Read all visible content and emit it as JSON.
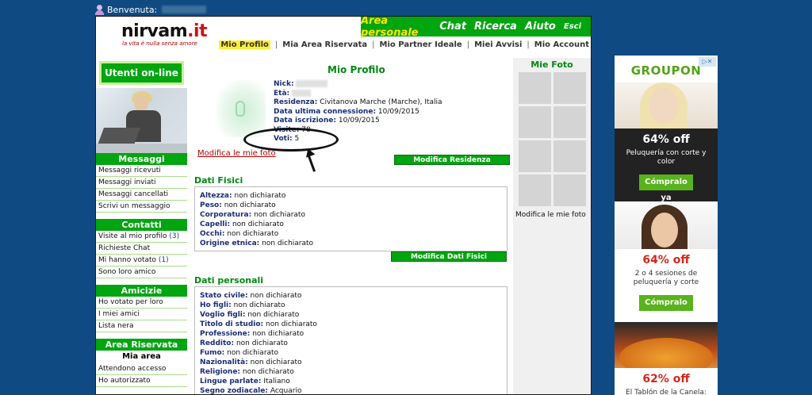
{
  "topbar": {
    "welcome": "Benvenuta:"
  },
  "header": {
    "logo_text": "nirvam",
    "logo_suffix": ".it",
    "tagline": "la vita è nulla senza amore",
    "mainnav": [
      "Area personale",
      "Chat",
      "Ricerca",
      "Aiuto",
      "Esci"
    ],
    "subnav": [
      "Mio Profilo",
      "Mia Area Riservata",
      "Mio Partner Ideale",
      "Miei Avvisi",
      "Mio Account"
    ]
  },
  "sidebar": {
    "online_button": "Utenti on-line",
    "messaggi": {
      "title": "Messaggi",
      "items": [
        "Messaggi ricevuti",
        "Messaggi inviati",
        "Messaggi cancellati",
        "Scrivi un messaggio"
      ]
    },
    "contatti": {
      "title": "Contatti",
      "items": [
        {
          "label": "Visite al mio profilo",
          "count": "(3)"
        },
        {
          "label": "Richieste Chat",
          "count": ""
        },
        {
          "label": "Mi hanno votato",
          "count": "(1)"
        },
        {
          "label": "Sono loro amico",
          "count": ""
        }
      ]
    },
    "amicizie": {
      "title": "Amicizie",
      "items": [
        "Ho votato per loro",
        "I miei amici",
        "Lista nera"
      ]
    },
    "area_riservata": {
      "title": "Area Riservata",
      "subtitle": "Mia area",
      "items": [
        "Attendono accesso",
        "Ho autorizzato"
      ]
    }
  },
  "profile": {
    "title": "Mio Profilo",
    "labels": {
      "nick": "Nick:",
      "eta": "Età:",
      "residenza": "Residenza:",
      "ultima": "Data ultima connessione:",
      "iscrizione": "Data iscrizione:",
      "visite": "Visite:",
      "voti": "Voti:"
    },
    "residenza": "Civitanova Marche (Marche), Italia",
    "ultima": "10/09/2015",
    "iscrizione": "10/09/2015",
    "visite": "78",
    "voti": "5",
    "modifica_foto": "Modifica le mie foto",
    "modifica_residenza": "Modifica Residenza"
  },
  "dati_fisici": {
    "title": "Dati Fisici",
    "rows": [
      {
        "label": "Altezza:",
        "value": "non dichiarato"
      },
      {
        "label": "Peso:",
        "value": "non dichiarato"
      },
      {
        "label": "Corporatura:",
        "value": "non dichiarato"
      },
      {
        "label": "Capelli:",
        "value": "non dichiarato"
      },
      {
        "label": "Occhi:",
        "value": "non dichiarato"
      },
      {
        "label": "Origine etnica:",
        "value": "non dichiarato"
      }
    ],
    "button": "Modifica Dati Fisici"
  },
  "dati_personali": {
    "title": "Dati personali",
    "rows": [
      {
        "label": "Stato civile:",
        "value": "non dichiarato"
      },
      {
        "label": "Ho figli:",
        "value": "non dichiarato"
      },
      {
        "label": "Voglio figli:",
        "value": "non dichiarato"
      },
      {
        "label": "Titolo di studio:",
        "value": "non dichiarato"
      },
      {
        "label": "Professione:",
        "value": "non dichiarato"
      },
      {
        "label": "Reddito:",
        "value": "non dichiarato"
      },
      {
        "label": "Fumo:",
        "value": "non dichiarato"
      },
      {
        "label": "Nazionalità:",
        "value": "non dichiarato"
      },
      {
        "label": "Religione:",
        "value": "non dichiarato"
      },
      {
        "label": "Lingue parlate:",
        "value": "Italiano"
      },
      {
        "label": "Segno zodiacale:",
        "value": "Acquario"
      }
    ]
  },
  "rightcol": {
    "title": "Mie Foto",
    "link": "Modifica le mie foto"
  },
  "ad": {
    "brand": "GROUPON",
    "deals": [
      {
        "price": "64% off",
        "desc": "Peluquería con corte y color",
        "button": "Cómpralo ya"
      },
      {
        "price": "64% off",
        "desc": "2 o 4 sesiones de peluquería y corte",
        "button": "Cómpralo ya"
      },
      {
        "price": "62% off",
        "desc": "El Tablón de la Canela:"
      }
    ]
  },
  "colors": {
    "brand_green": "#00a50f",
    "page_bg": "#0f4a82",
    "highlight": "#ffef33",
    "link_red": "#b40000"
  }
}
